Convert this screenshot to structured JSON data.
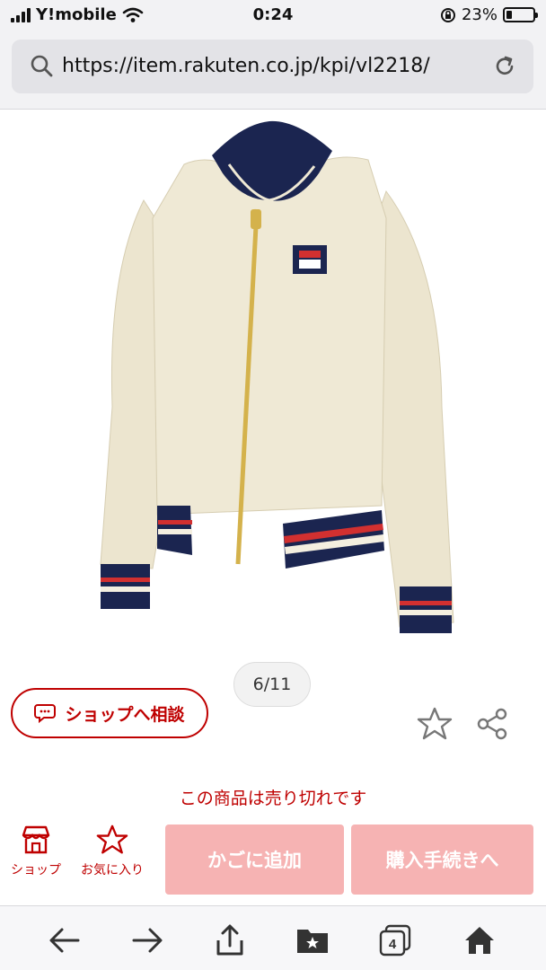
{
  "status_bar": {
    "carrier": "Y!mobile",
    "time": "0:24",
    "battery": "23%"
  },
  "browser": {
    "url": "https://item.rakuten.co.jp/kpi/vl2218/"
  },
  "product": {
    "image_icon": "track-jacket-image",
    "image_counter": "6/11",
    "consult_button": "ショップへ相談",
    "sold_out_text": "この商品は売り切れです"
  },
  "actions": {
    "shop_label": "ショップ",
    "favorite_label": "お気に入り",
    "cart_button": "かごに追加",
    "checkout_button": "購入手続きへ"
  },
  "toolbar": {
    "tab_count": "4"
  },
  "colors": {
    "brand_red": "#bf0000",
    "disabled_button": "#f6b3b3"
  }
}
